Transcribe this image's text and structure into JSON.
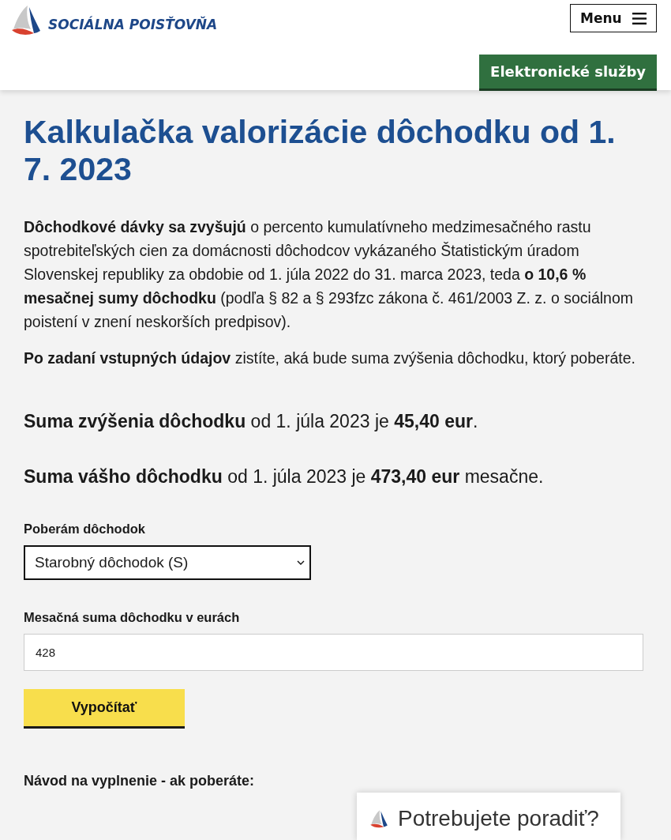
{
  "header": {
    "logo_text": "SOCIÁLNA POISŤOVŇA",
    "menu_button": "Menu",
    "eservices_button": "Elektronické služby"
  },
  "title": "Kalkulačka valorizácie dôchodku od 1. 7. 2023",
  "intro": [
    "**Dôchodkové dávky sa zvyšujú** o percento kumulatívneho medzimesačného rastu spotrebiteľských cien za domácnosti dôchodcov vykázaného Štatistickým úradom Slovenskej republiky za obdobie od 1. júla 2022 do 31. marca 2023, teda **o 10,6 % mesačnej sumy dôchodku** (podľa § 82 a § 293fzc zákona č. 461/2003 Z. z. o sociálnom poistení v znení neskorších predpisov).",
    "**Po zadaní vstupných údajov** zistíte, aká bude suma zvýšenia dôchodku, ktorý poberáte."
  ],
  "results": [
    "**Suma zvýšenia dôchodku** od 1. júla 2023 je **45,40 eur**.",
    "**Suma vášho dôchodku** od 1. júla 2023 je **473,40 eur** mesačne."
  ],
  "form": {
    "pension_type": {
      "label": "Poberám dôchodok",
      "value": "Starobný dôchodok (S)"
    },
    "monthly_amount": {
      "label": "Mesačná suma dôchodku v eurách",
      "value": "428"
    },
    "submit_button": "Vypočítať"
  },
  "instructions_heading": "Návod na vyplnenie - ak poberáte:",
  "chat_widget": {
    "label": "Potrebujete poradiť?"
  }
}
